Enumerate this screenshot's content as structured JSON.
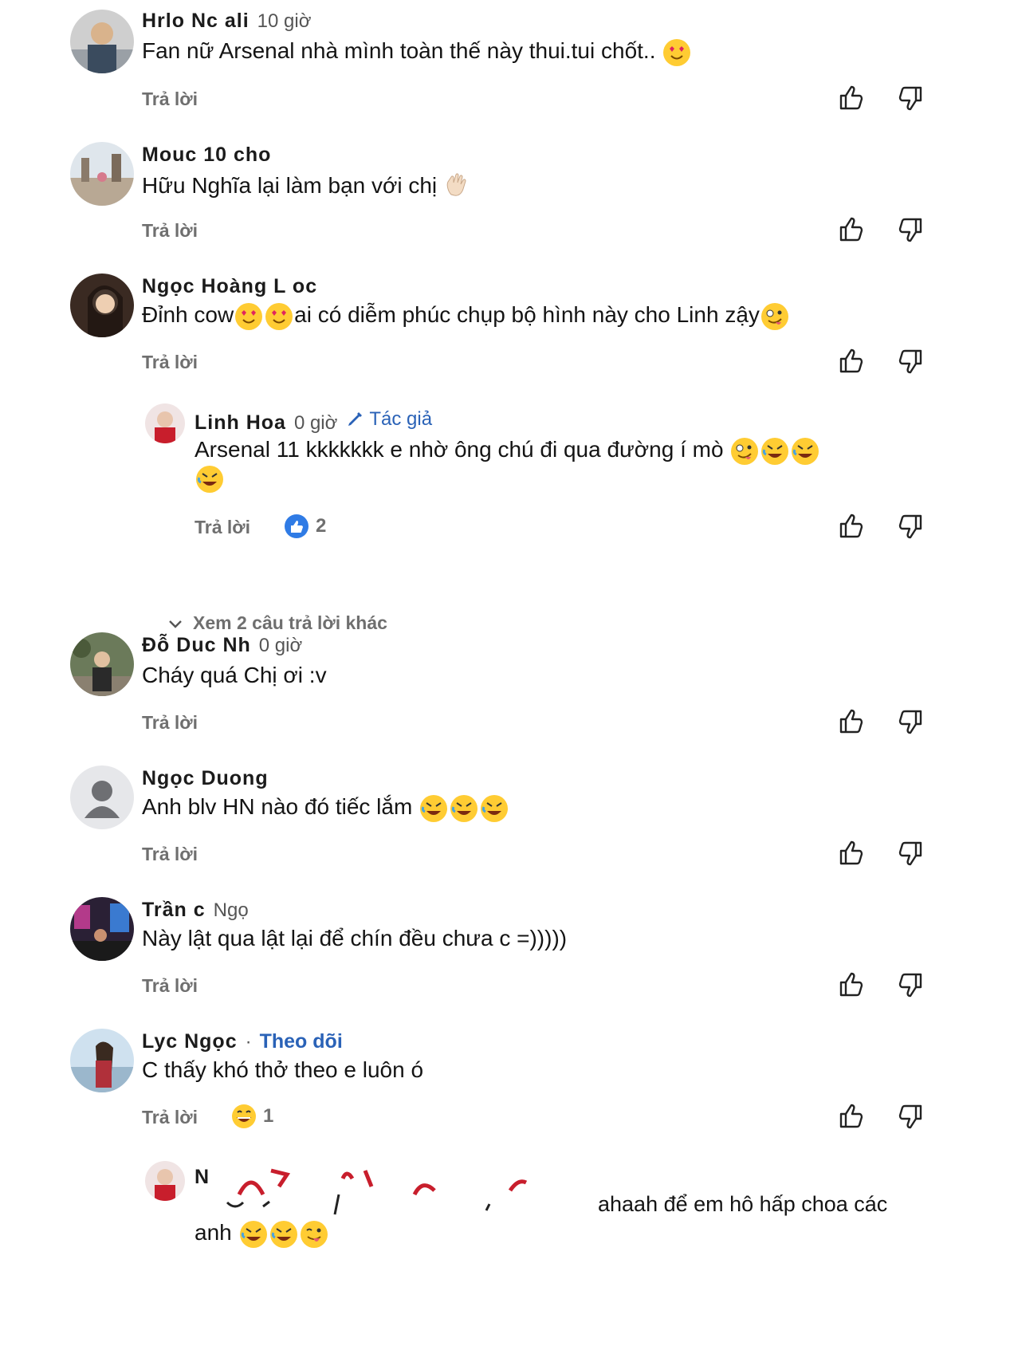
{
  "comments": [
    {
      "name": "Hrlo Nc ali",
      "time": "10 giờ",
      "text": "Fan nữ Arsenal nhà mình toàn thế này thui.tui chốt..",
      "reply": "Trả lời"
    },
    {
      "name": "Mouc 10 cho",
      "time": "",
      "text": "Hữu Nghĩa lại làm bạn với chị",
      "reply": "Trả lời"
    },
    {
      "name": "Ngọc Hoàng L oc",
      "time": "",
      "text_a": "Đỉnh cow",
      "text_b": "ai có diễm phúc chụp bộ hình này cho Linh zậy",
      "reply": "Trả lời"
    },
    {
      "name": "Linh Hoa",
      "time": "0 giờ",
      "author": "Tác giả",
      "text": "Arsenal 11 kkkkkkk e nhờ ông chú đi qua đường í mò",
      "reply": "Trả lời",
      "likes": "2"
    },
    {
      "name": "Đỗ Duc Nh",
      "time": "0 giờ",
      "text": "Cháy quá Chị ơi :v",
      "reply": "Trả lời"
    },
    {
      "name": "Ngọc Duong",
      "time": "",
      "text": "Anh blv HN nào đó tiếc lắm",
      "reply": "Trả lời"
    },
    {
      "name": "Trần c",
      "time": "Ngọ",
      "text": "Này lật qua lật lại để chín đều chưa c =)))))",
      "reply": "Trả lời"
    },
    {
      "name": "Lyc Ngọc",
      "time": "",
      "follow": "Theo dõi",
      "text": "C thấy khó thở theo e luôn ó",
      "reply": "Trả lời",
      "reactions": "1"
    },
    {
      "name": "N",
      "text": "ahaah để em hô hấp choa các",
      "text2": "anh"
    }
  ],
  "more_replies": "Xem 2 câu trả lời khác",
  "icons": {
    "like": "thumbs-up-icon",
    "dislike": "thumbs-down-icon",
    "expand": "chevron-down-icon",
    "author": "pen-icon"
  },
  "colors": {
    "link": "#2a62b7",
    "muted": "#6f6f6f",
    "text": "#141414"
  }
}
